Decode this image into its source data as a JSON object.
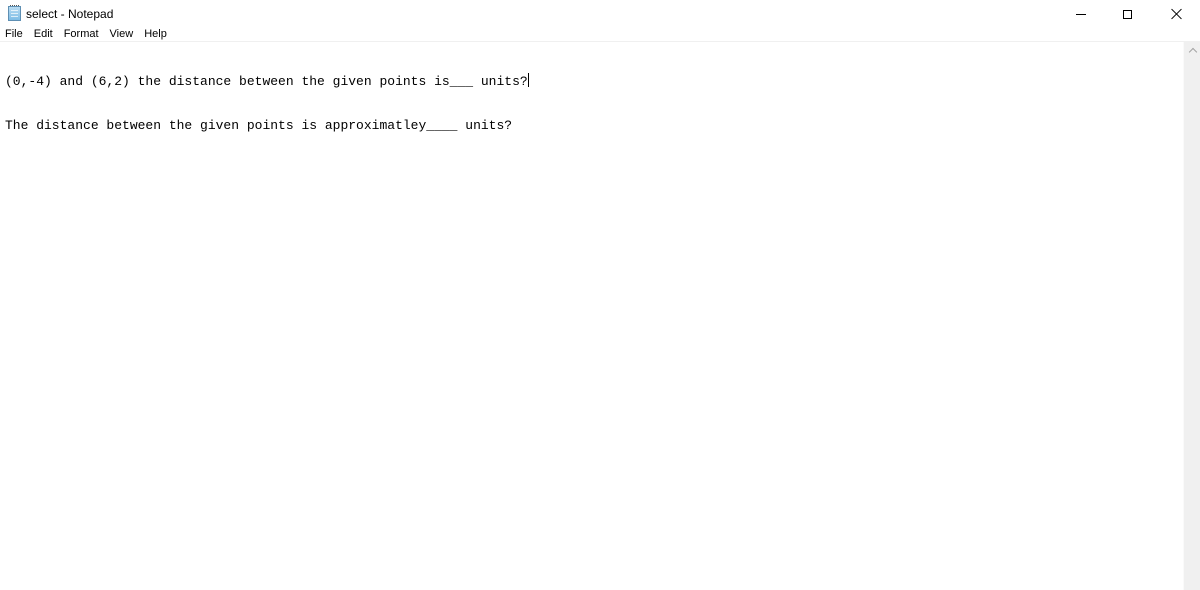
{
  "window": {
    "title": "select - Notepad",
    "icon": "notepad-icon",
    "controls": {
      "minimize": "minimize-icon",
      "maximize": "maximize-icon",
      "close": "close-icon"
    }
  },
  "menubar": {
    "items": [
      {
        "label": "File"
      },
      {
        "label": "Edit"
      },
      {
        "label": "Format"
      },
      {
        "label": "View"
      },
      {
        "label": "Help"
      }
    ]
  },
  "editor": {
    "lines": [
      "(0,-4) and (6,2) the distance between the given points is___ units?",
      "The distance between the given points is approximatley____ units?"
    ],
    "caret_line": 1
  },
  "scrollbar": {
    "up_arrow": "chevron-up-icon"
  },
  "colors": {
    "background": "#ffffff",
    "text": "#000000",
    "scrollbar_track": "#f0f0f0",
    "scroll_arrow": "#a3a3a3"
  }
}
